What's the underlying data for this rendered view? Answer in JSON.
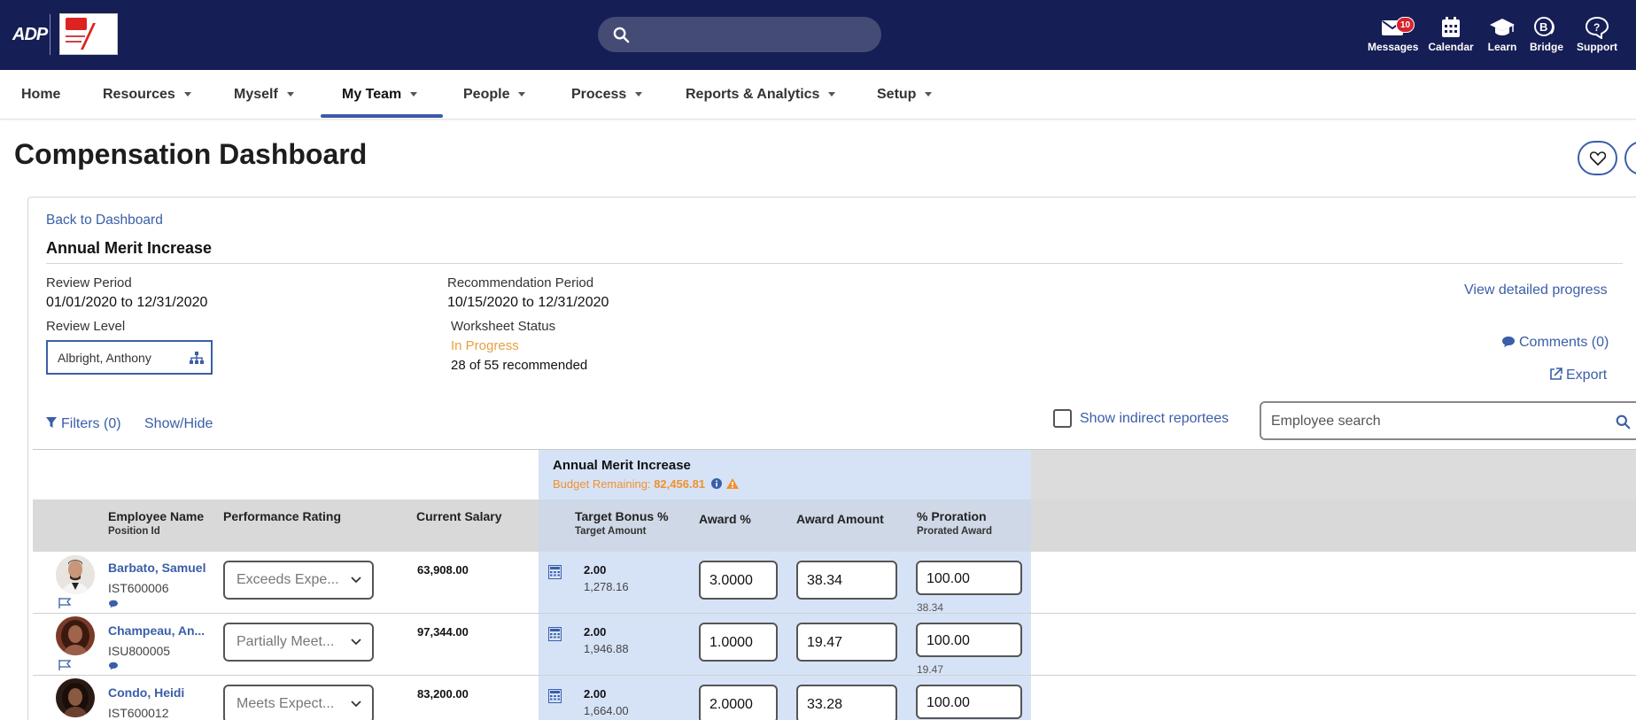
{
  "topbar": {
    "logo_text": "ADP",
    "messages": {
      "label": "Messages",
      "count": "10"
    },
    "calendar": "Calendar",
    "learn": "Learn",
    "bridge": "Bridge",
    "support": "Support"
  },
  "nav": {
    "items": [
      "Home",
      "Resources",
      "Myself",
      "My Team",
      "People",
      "Process",
      "Reports & Analytics",
      "Setup"
    ],
    "active": "My Team"
  },
  "page": {
    "title": "Compensation Dashboard"
  },
  "card": {
    "back_link": "Back to Dashboard",
    "section_title": "Annual Merit Increase",
    "review_period_label": "Review Period",
    "review_period_value": "01/01/2020 to 12/31/2020",
    "recommendation_period_label": "Recommendation Period",
    "recommendation_period_value": "10/15/2020 to 12/31/2020",
    "review_level_label": "Review Level",
    "review_level_value": "Albright, Anthony",
    "worksheet_status_label": "Worksheet Status",
    "worksheet_status_value": "In Progress",
    "recommended_count": "28 of 55 recommended",
    "view_progress": "View detailed progress",
    "comments": "Comments (0)",
    "export": "Export",
    "filters": "Filters (0)",
    "show_hide": "Show/Hide",
    "show_indirect": "Show indirect reportees",
    "employee_search_placeholder": "Employee search"
  },
  "colors": {
    "primary": "#3a5ea8",
    "topbar": "#151e55",
    "status_orange": "#e8a040",
    "budget_orange": "#f0912e",
    "badge_red": "#d7232e"
  },
  "table": {
    "group_title": "Annual Merit Increase",
    "budget_label": "Budget Remaining:",
    "budget_value": "82,456.81",
    "headers": {
      "employee_name": "Employee Name",
      "position_id": "Position Id",
      "performance_rating": "Performance Rating",
      "current_salary": "Current Salary",
      "target_bonus": "Target Bonus %",
      "target_amount": "Target Amount",
      "award_pct": "Award %",
      "award_amount": "Award Amount",
      "proration": "% Proration",
      "prorated_award": "Prorated Award"
    },
    "rows": [
      {
        "name": "Barbato, Samuel",
        "id": "IST600006",
        "rating": "Exceeds Expe...",
        "salary": "63,908.00",
        "target_bonus": "2.00",
        "target_amount": "1,278.16",
        "award_pct": "3.0000",
        "award_amount": "38.34",
        "proration": "100.00",
        "prorated_award": "38.34"
      },
      {
        "name": "Champeau, An...",
        "id": "ISU800005",
        "rating": "Partially Meet...",
        "salary": "97,344.00",
        "target_bonus": "2.00",
        "target_amount": "1,946.88",
        "award_pct": "1.0000",
        "award_amount": "19.47",
        "proration": "100.00",
        "prorated_award": "19.47"
      },
      {
        "name": "Condo, Heidi",
        "id": "IST600012",
        "rating": "Meets Expect...",
        "salary": "83,200.00",
        "target_bonus": "2.00",
        "target_amount": "1,664.00",
        "award_pct": "2.0000",
        "award_amount": "33.28",
        "proration": "100.00",
        "prorated_award": ""
      }
    ]
  }
}
